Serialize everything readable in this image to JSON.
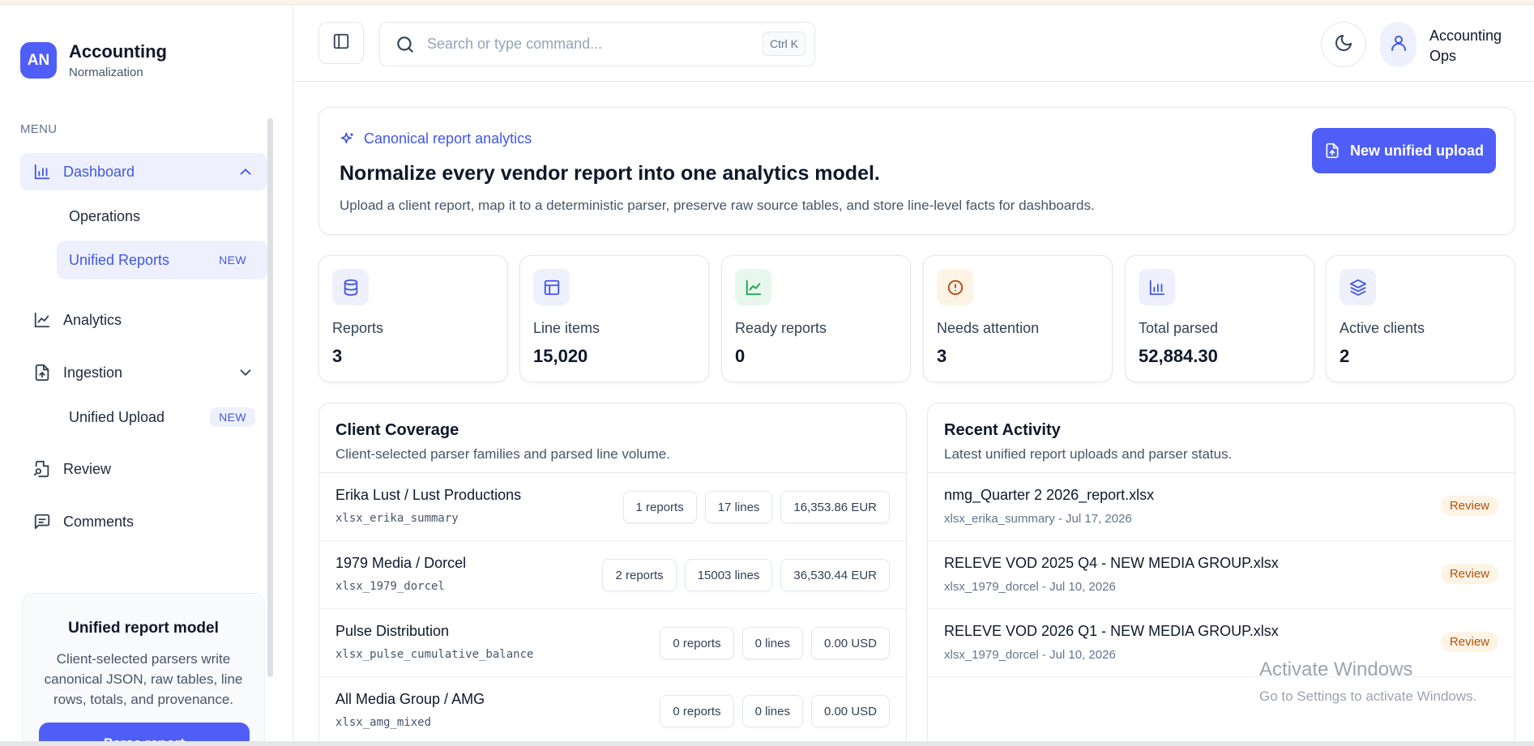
{
  "brand": {
    "initials": "AN",
    "title": "Accounting",
    "subtitle": "Normalization"
  },
  "sidebar": {
    "menu_label": "MENU",
    "items": [
      {
        "label": "Dashboard",
        "icon": "bar-chart-icon"
      },
      {
        "label": "Operations"
      },
      {
        "label": "Unified Reports",
        "badge": "NEW"
      },
      {
        "label": "Analytics",
        "icon": "line-chart-icon"
      },
      {
        "label": "Ingestion",
        "icon": "file-upload-icon"
      },
      {
        "label": "Unified Upload",
        "badge": "NEW"
      },
      {
        "label": "Review",
        "icon": "file-search-icon"
      },
      {
        "label": "Comments",
        "icon": "message-icon"
      }
    ],
    "promo": {
      "title": "Unified report model",
      "body": "Client-selected parsers write canonical JSON, raw tables, line rows, totals, and provenance.",
      "button": "Parse report"
    }
  },
  "header": {
    "search_placeholder": "Search or type command...",
    "shortcut": "Ctrl K",
    "user_name": "Accounting Ops"
  },
  "hero": {
    "kicker": "Canonical report analytics",
    "title": "Normalize every vendor report into one analytics model.",
    "description": "Upload a client report, map it to a deterministic parser, preserve raw source tables, and store line-level facts for dashboards.",
    "button": "New unified upload"
  },
  "stats": [
    {
      "label": "Reports",
      "value": "3",
      "icon": "database-icon"
    },
    {
      "label": "Line items",
      "value": "15,020",
      "icon": "table-icon"
    },
    {
      "label": "Ready reports",
      "value": "0",
      "icon": "trend-icon"
    },
    {
      "label": "Needs attention",
      "value": "3",
      "icon": "alert-icon"
    },
    {
      "label": "Total parsed",
      "value": "52,884.30",
      "icon": "bar-chart-icon"
    },
    {
      "label": "Active clients",
      "value": "2",
      "icon": "layers-icon"
    }
  ],
  "coverage": {
    "title": "Client Coverage",
    "subtitle": "Client-selected parser families and parsed line volume.",
    "rows": [
      {
        "name": "Erika Lust / Lust Productions",
        "parser": "xlsx_erika_summary",
        "reports": "1 reports",
        "lines": "17 lines",
        "total": "16,353.86 EUR"
      },
      {
        "name": "1979 Media / Dorcel",
        "parser": "xlsx_1979_dorcel",
        "reports": "2 reports",
        "lines": "15003 lines",
        "total": "36,530.44 EUR"
      },
      {
        "name": "Pulse Distribution",
        "parser": "xlsx_pulse_cumulative_balance",
        "reports": "0 reports",
        "lines": "0 lines",
        "total": "0.00 USD"
      },
      {
        "name": "All Media Group / AMG",
        "parser": "xlsx_amg_mixed",
        "reports": "0 reports",
        "lines": "0 lines",
        "total": "0.00 USD"
      }
    ]
  },
  "activity": {
    "title": "Recent Activity",
    "subtitle": "Latest unified report uploads and parser status.",
    "rows": [
      {
        "file": "nmg_Quarter 2 2026_report.xlsx",
        "meta": "xlsx_erika_summary - Jul 17, 2026",
        "status": "Review"
      },
      {
        "file": "RELEVE VOD 2025 Q4 - NEW MEDIA GROUP.xlsx",
        "meta": "xlsx_1979_dorcel - Jul 10, 2026",
        "status": "Review"
      },
      {
        "file": "RELEVE VOD 2026 Q1 - NEW MEDIA GROUP.xlsx",
        "meta": "xlsx_1979_dorcel - Jul 10, 2026",
        "status": "Review"
      }
    ]
  },
  "watermark": {
    "line1": "Activate Windows",
    "line2": "Go to Settings to activate Windows."
  },
  "colors": {
    "accent": "#4f5ef7",
    "accent_text": "#4256e8",
    "active_bg": "#eef1fd",
    "review": "#b45309"
  }
}
